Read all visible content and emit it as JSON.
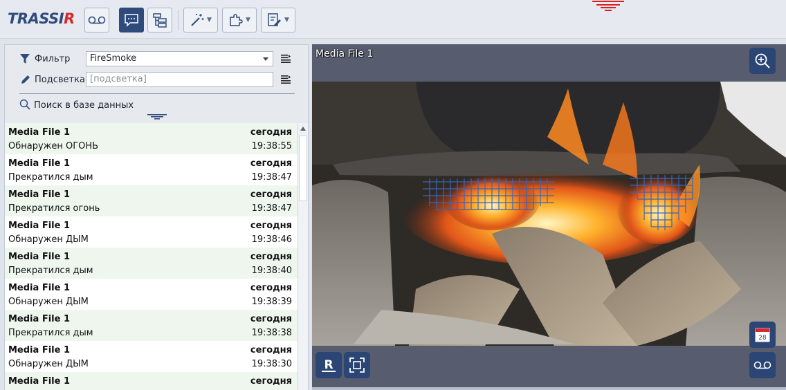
{
  "app": {
    "logo_main": "TRASSI",
    "logo_accent": "R"
  },
  "toolbar": {
    "buttons": [
      {
        "name": "archive-button",
        "icon": "tape-icon",
        "active": false
      },
      {
        "name": "events-button",
        "icon": "chat-icon",
        "active": true
      },
      {
        "name": "tree-button",
        "icon": "tree-icon",
        "active": false
      },
      {
        "name": "wand-menu-button",
        "icon": "magic-wand-icon",
        "active": false
      },
      {
        "name": "plugins-menu-button",
        "icon": "puzzle-icon",
        "active": false
      },
      {
        "name": "settings-menu-button",
        "icon": "settings-icon",
        "active": false
      }
    ],
    "accent_color": "#2f4b7c",
    "alarm_color": "#e02020"
  },
  "filters": {
    "filter_label": "Фильтр",
    "filter_value": "FireSmoke",
    "highlight_label": "Подсветка",
    "highlight_placeholder": "[подсветка]",
    "db_search_label": "Поиск в базе данных"
  },
  "events": [
    {
      "source": "Media File 1",
      "date": "сегодня",
      "message": "Обнаружен ОГОНЬ",
      "time": "19:38:55"
    },
    {
      "source": "Media File 1",
      "date": "сегодня",
      "message": "Прекратился дым",
      "time": "19:38:47"
    },
    {
      "source": "Media File 1",
      "date": "сегодня",
      "message": "Прекратился огонь",
      "time": "19:38:47"
    },
    {
      "source": "Media File 1",
      "date": "сегодня",
      "message": "Обнаружен ДЫМ",
      "time": "19:38:46"
    },
    {
      "source": "Media File 1",
      "date": "сегодня",
      "message": "Прекратился дым",
      "time": "19:38:40"
    },
    {
      "source": "Media File 1",
      "date": "сегодня",
      "message": "Обнаружен ДЫМ",
      "time": "19:38:39"
    },
    {
      "source": "Media File 1",
      "date": "сегодня",
      "message": "Прекратился дым",
      "time": "19:38:38"
    },
    {
      "source": "Media File 1",
      "date": "сегодня",
      "message": "Обнаружен ДЫМ",
      "time": "19:38:30"
    },
    {
      "source": "Media File 1",
      "date": "сегодня",
      "message": "",
      "time": ""
    }
  ],
  "video": {
    "title": "Media File 1",
    "calendar_day": "28",
    "record_letter": "R"
  }
}
